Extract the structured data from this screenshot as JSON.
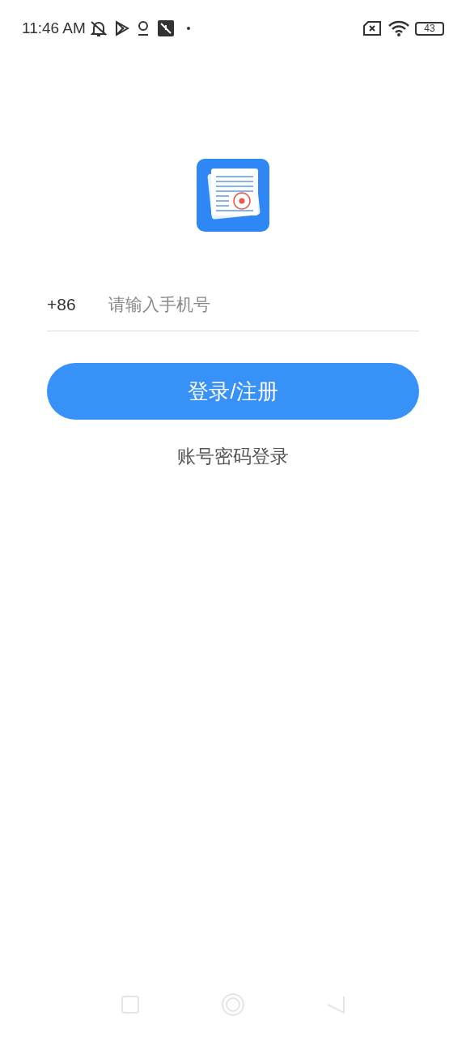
{
  "status_bar": {
    "time": "11:46 AM",
    "battery": "43"
  },
  "phone_field": {
    "country_code": "+86",
    "placeholder": "请输入手机号"
  },
  "login_button": "登录/注册",
  "password_login_link": "账号密码登录"
}
